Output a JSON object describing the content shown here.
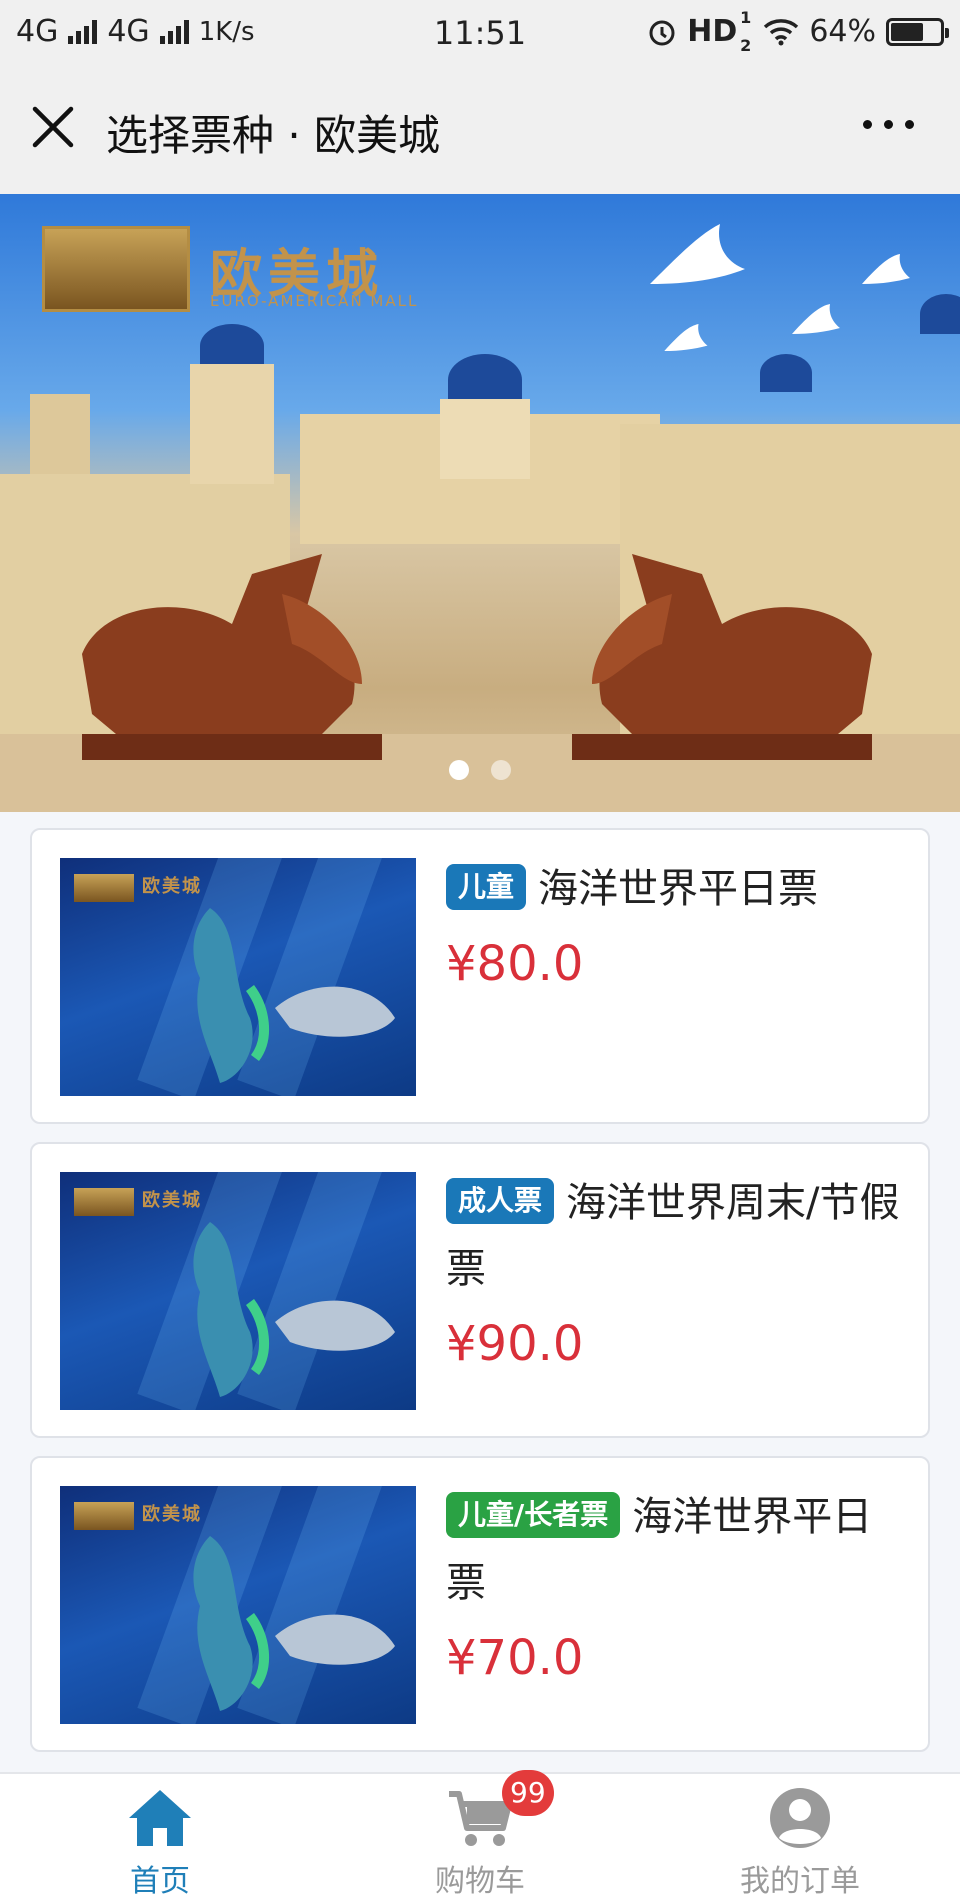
{
  "status_bar": {
    "network1": "4G",
    "network2": "4G",
    "speed": "1K/s",
    "time": "11:51",
    "hd": "HD",
    "hd_sup": "1",
    "hd_sub": "2",
    "battery": "64%"
  },
  "navbar": {
    "title": "选择票种 · 欧美城"
  },
  "banner": {
    "logo_text": "欧美城",
    "logo_subtext": "EURO-AMERICAN MALL",
    "slide_count": 2,
    "active_slide": 1
  },
  "thumbnail": {
    "logo_text": "欧美城"
  },
  "tickets": [
    {
      "tag": "儿童",
      "tag_color": "#1a78b8",
      "name": "海洋世界平日票",
      "price": "¥80.0"
    },
    {
      "tag": "成人票",
      "tag_color": "#1a78b8",
      "name": "海洋世界周末/节假票",
      "price": "¥90.0"
    },
    {
      "tag": "儿童/长者票",
      "tag_color": "#2aa244",
      "name": "海洋世界平日票",
      "price": "¥70.0"
    }
  ],
  "tabbar": {
    "items": [
      {
        "label": "首页",
        "icon": "home-icon",
        "active": true
      },
      {
        "label": "购物车",
        "icon": "cart-icon",
        "badge": "99"
      },
      {
        "label": "我的订单",
        "icon": "user-icon"
      }
    ]
  },
  "colors": {
    "accent": "#1f7fb8",
    "price": "#d9303a",
    "badge": "#e33b3b"
  }
}
